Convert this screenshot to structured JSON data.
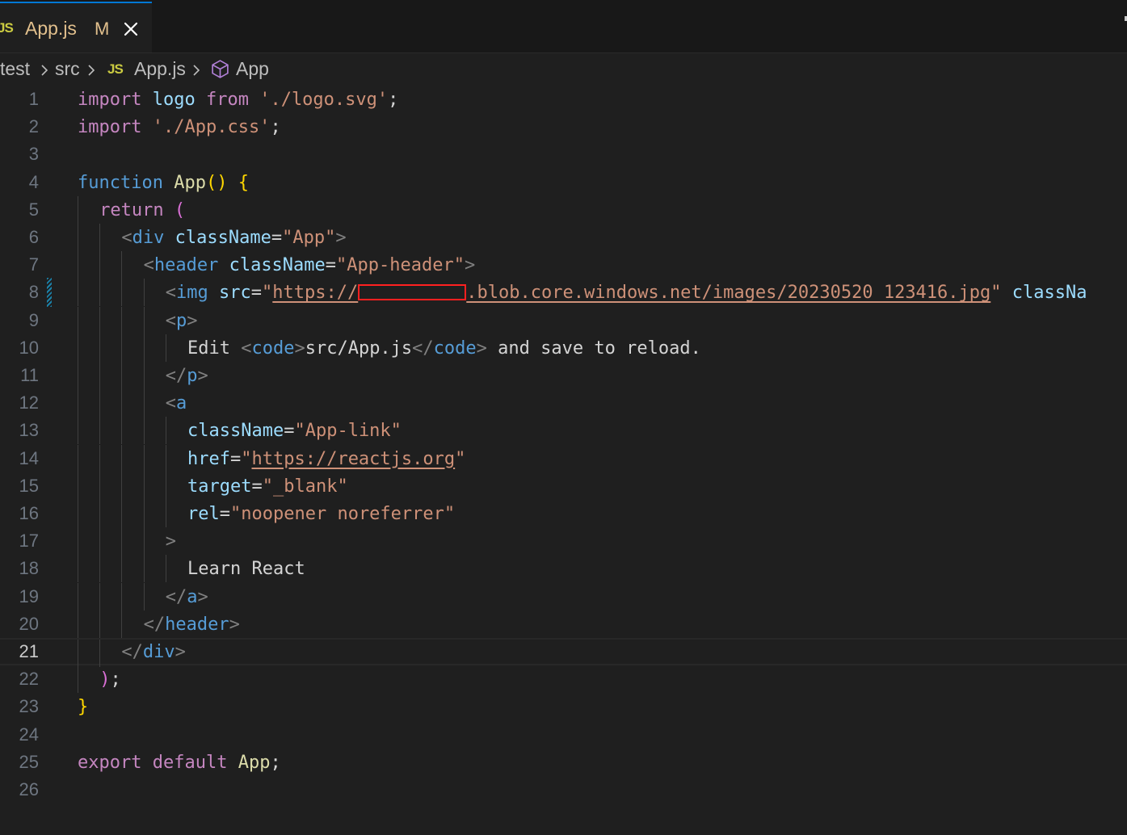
{
  "tab": {
    "icon": "JS",
    "filename": "App.js",
    "status": "M",
    "close_icon": "close-icon"
  },
  "breadcrumb": {
    "items": [
      "test",
      "src",
      "App.js",
      "App"
    ],
    "file_icon": "JS",
    "symbol_icon": "cube-icon"
  },
  "editor": {
    "current_line": 21,
    "line_numbers": [
      "1",
      "2",
      "3",
      "4",
      "5",
      "6",
      "7",
      "8",
      "9",
      "10",
      "11",
      "12",
      "13",
      "14",
      "15",
      "16",
      "17",
      "18",
      "19",
      "20",
      "21",
      "22",
      "23",
      "24",
      "25",
      "26"
    ],
    "lines": [
      [
        [
          "import",
          "ctrl"
        ],
        [
          " "
        ],
        [
          "logo",
          "var"
        ],
        [
          " "
        ],
        [
          "from",
          "ctrl"
        ],
        [
          " "
        ],
        [
          "'./logo.svg'",
          "str"
        ],
        [
          ";",
          "txt"
        ]
      ],
      [
        [
          "import",
          "ctrl"
        ],
        [
          " "
        ],
        [
          "'./App.css'",
          "str"
        ],
        [
          ";",
          "txt"
        ]
      ],
      [],
      [
        [
          "function",
          "dec"
        ],
        [
          " "
        ],
        [
          "App",
          "fn"
        ],
        [
          "()",
          "br1"
        ],
        [
          " "
        ],
        [
          "{",
          "br1"
        ]
      ],
      [
        [
          "return",
          "ctrl"
        ],
        [
          " "
        ],
        [
          "(",
          "br2"
        ]
      ],
      [
        [
          "<",
          "punc"
        ],
        [
          "div",
          "tag"
        ],
        [
          " "
        ],
        [
          "className",
          "attr"
        ],
        [
          "=",
          "txt"
        ],
        [
          "\"App\"",
          "str"
        ],
        [
          ">",
          "punc"
        ]
      ],
      [
        [
          "<",
          "punc"
        ],
        [
          "header",
          "tag"
        ],
        [
          " "
        ],
        [
          "className",
          "attr"
        ],
        [
          "=",
          "txt"
        ],
        [
          "\"App-header\"",
          "str"
        ],
        [
          ">",
          "punc"
        ]
      ],
      [
        [
          "<",
          "punc"
        ],
        [
          "img",
          "tag"
        ],
        [
          " "
        ],
        [
          "src",
          "attr"
        ],
        [
          "=",
          "txt"
        ],
        [
          "\"",
          "str"
        ],
        [
          "https://",
          "url"
        ],
        [
          "REDACT",
          "redact"
        ],
        [
          ".blob.core.windows.net/images/20230520_123416.jpg",
          "url"
        ],
        [
          "\"",
          "str"
        ],
        [
          " "
        ],
        [
          "classNa",
          "attr"
        ]
      ],
      [
        [
          "<",
          "punc"
        ],
        [
          "p",
          "tag"
        ],
        [
          ">",
          "punc"
        ]
      ],
      [
        [
          "Edit ",
          "txt"
        ],
        [
          "<",
          "punc"
        ],
        [
          "code",
          "tag"
        ],
        [
          ">",
          "punc"
        ],
        [
          "src/App.js",
          "txt"
        ],
        [
          "</",
          "punc"
        ],
        [
          "code",
          "tag"
        ],
        [
          ">",
          "punc"
        ],
        [
          " and save to reload.",
          "txt"
        ]
      ],
      [
        [
          "</",
          "punc"
        ],
        [
          "p",
          "tag"
        ],
        [
          ">",
          "punc"
        ]
      ],
      [
        [
          "<",
          "punc"
        ],
        [
          "a",
          "tag"
        ]
      ],
      [
        [
          "className",
          "attr"
        ],
        [
          "=",
          "txt"
        ],
        [
          "\"App-link\"",
          "str"
        ]
      ],
      [
        [
          "href",
          "attr"
        ],
        [
          "=",
          "txt"
        ],
        [
          "\"",
          "str"
        ],
        [
          "https://reactjs.org",
          "url"
        ],
        [
          "\"",
          "str"
        ]
      ],
      [
        [
          "target",
          "attr"
        ],
        [
          "=",
          "txt"
        ],
        [
          "\"_blank\"",
          "str"
        ]
      ],
      [
        [
          "rel",
          "attr"
        ],
        [
          "=",
          "txt"
        ],
        [
          "\"noopener noreferrer\"",
          "str"
        ]
      ],
      [
        [
          ">",
          "punc"
        ]
      ],
      [
        [
          "Learn React",
          "txt"
        ]
      ],
      [
        [
          "</",
          "punc"
        ],
        [
          "a",
          "tag"
        ],
        [
          ">",
          "punc"
        ]
      ],
      [
        [
          "</",
          "punc"
        ],
        [
          "header",
          "tag"
        ],
        [
          ">",
          "punc"
        ]
      ],
      [
        [
          "</",
          "punc"
        ],
        [
          "div",
          "tag"
        ],
        [
          ">",
          "punc"
        ]
      ],
      [
        [
          ")",
          "br2"
        ],
        [
          ";",
          "txt"
        ]
      ],
      [
        [
          "}",
          "br1"
        ]
      ],
      [],
      [
        [
          "export",
          "ctrl"
        ],
        [
          " "
        ],
        [
          "default",
          "ctrl"
        ],
        [
          " "
        ],
        [
          "App",
          "fn"
        ],
        [
          ";",
          "txt"
        ]
      ],
      []
    ],
    "indent_levels": [
      0,
      0,
      0,
      0,
      1,
      2,
      3,
      4,
      4,
      5,
      4,
      4,
      5,
      5,
      5,
      5,
      4,
      5,
      4,
      3,
      2,
      1,
      0,
      0,
      0,
      0
    ],
    "modified_line": 8,
    "colors": {
      "background": "#1f1f1f",
      "keyword_control": "#c586c0",
      "keyword_declaration": "#569cd6",
      "function_name": "#dcdcaa",
      "string": "#ce9178",
      "attribute": "#9cdcfe",
      "tag": "#569cd6",
      "redaction_box": "#ff2020"
    }
  }
}
